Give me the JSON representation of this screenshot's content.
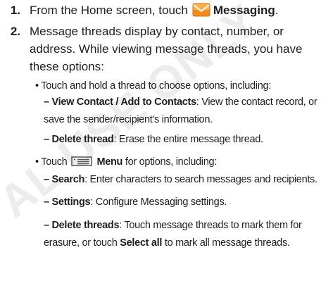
{
  "watermark": "AL USE ONLY",
  "step1": {
    "number": "1.",
    "text_before": "From the Home screen, touch",
    "icon": "messaging-envelope-icon",
    "label": "Messaging",
    "text_after": "."
  },
  "step2": {
    "number": "2.",
    "text": "Message threads display by contact, number, or address. While viewing message threads, you have these options:",
    "bullet1": {
      "marker": "•",
      "text": "Touch and hold a thread to choose options, including:",
      "items": [
        {
          "label": "View Contact / Add to Contacts",
          "text": ": View the contact record, or save the sender/recipient's information."
        },
        {
          "label": "Delete thread",
          "text": ": Erase the entire message thread."
        }
      ]
    },
    "bullet2": {
      "marker": "•",
      "text_before": "Touch",
      "icon": "menu-icon",
      "label": "Menu",
      "text_after": "for options, including:",
      "items": [
        {
          "label": "Search",
          "text": ": Enter characters to search messages and recipients."
        },
        {
          "label": "Settings",
          "text": ": Configure Messaging settings."
        },
        {
          "label": "Delete threads",
          "text_before": ": Touch message threads to mark them for erasure, or touch",
          "inline_label": "Select all",
          "text_after": "to mark all message threads."
        }
      ]
    }
  },
  "dash": "–"
}
